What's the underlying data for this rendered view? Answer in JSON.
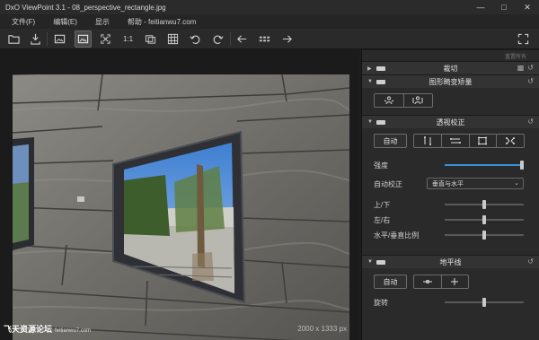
{
  "window": {
    "title": "DxO ViewPoint 3.1 - 08_perspective_rectangle.jpg"
  },
  "menu": [
    "文件(F)",
    "编辑(E)",
    "显示",
    "帮助 - feitianwu7.com"
  ],
  "toolbar": {
    "zoom_label": "1:1"
  },
  "viewer": {
    "image_size": "2000 x 1333 px",
    "watermark": "飞天资源论坛",
    "watermark_url": "feitianwu7.com"
  },
  "panel": {
    "top_link": "重置所有",
    "sections": {
      "crop": {
        "title": "裁切"
      },
      "volume": {
        "title": "图形畸变矫量"
      },
      "perspective": {
        "title": "透视校正",
        "auto_label": "自动",
        "intensity_label": "强度",
        "auto_correct_label": "自动校正",
        "auto_correct_value": "垂直与水平",
        "vertical_label": "上/下",
        "horizontal_label": "左/右",
        "ratio_label": "水平/垂直比例"
      },
      "horizon": {
        "title": "地平线",
        "auto_label": "自动",
        "rotate_label": "旋转"
      }
    }
  },
  "colors": {
    "accent": "#3b8fd6",
    "panel_bg": "#2a2a2a",
    "viewer_bg": "#1b1b1b"
  }
}
